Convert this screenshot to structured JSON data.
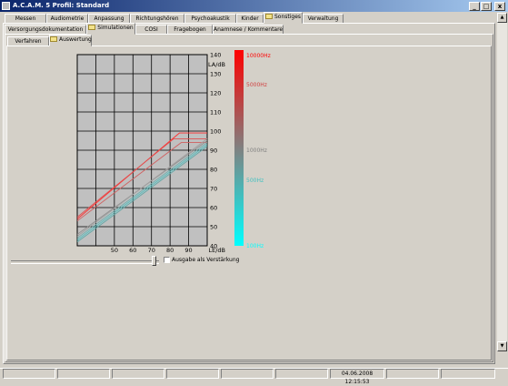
{
  "window": {
    "title": "A.C.A.M. 5  Profil: Standard",
    "minimize": "_",
    "maximize": "□",
    "close": "x"
  },
  "main_tabs": [
    {
      "label": "Messen"
    },
    {
      "label": "Audiometrie"
    },
    {
      "label": "Anpassung"
    },
    {
      "label": "Richtungshören"
    },
    {
      "label": "Psychoakustik"
    },
    {
      "label": "Kinder"
    },
    {
      "label": "Sonstiges"
    },
    {
      "label": "Verwaltung"
    }
  ],
  "sub_tabs": [
    {
      "label": "Versorgungsdokumentation"
    },
    {
      "label": "Simulationen"
    },
    {
      "label": "COSI"
    },
    {
      "label": "Fragebogen"
    },
    {
      "label": "Anamnese / Kommentare"
    }
  ],
  "third_tabs": [
    {
      "label": "Verfahren"
    },
    {
      "label": "Auswertung"
    }
  ],
  "checkbox": {
    "label": "Ausgabe als Verstärkung",
    "checked": false
  },
  "slider": {
    "value": 0.98
  },
  "status": {
    "datetime": "04.06.2008 12:15:53"
  },
  "colors": {
    "title_start": "#0a246a",
    "title_end": "#a6caf0",
    "plot_bg": "#c0c0c0"
  },
  "chart_data": {
    "type": "line",
    "xlabel": "LE/dB",
    "ylabel": "LA/dB",
    "x_ticks": [
      50,
      60,
      70,
      80,
      90
    ],
    "y_ticks": [
      40,
      50,
      60,
      70,
      80,
      90,
      100,
      110,
      120,
      130,
      140
    ],
    "xlim": [
      30,
      100
    ],
    "ylim": [
      40,
      140
    ],
    "grid": true,
    "colorbar": {
      "labels": [
        "10000Hz",
        "5000Hz",
        "1000Hz",
        "500Hz",
        "100Hz"
      ],
      "colors": [
        "#ff0000",
        "#d04040",
        "#808080",
        "#40c0c0",
        "#00ffff"
      ]
    },
    "series": [
      {
        "color": "#ff3030",
        "points": [
          [
            30,
            54
          ],
          [
            85,
            99
          ],
          [
            100,
            99
          ]
        ]
      },
      {
        "color": "#e05050",
        "points": [
          [
            30,
            55
          ],
          [
            82,
            96
          ],
          [
            100,
            96
          ]
        ]
      },
      {
        "color": "#d06060",
        "points": [
          [
            30,
            53
          ],
          [
            86,
            94
          ],
          [
            100,
            94
          ]
        ]
      },
      {
        "color": "#909090",
        "points": [
          [
            30,
            46
          ],
          [
            100,
            95
          ]
        ]
      },
      {
        "color": "#70b0b0",
        "points": [
          [
            30,
            44
          ],
          [
            100,
            94
          ]
        ]
      },
      {
        "color": "#50c0c0",
        "points": [
          [
            30,
            43
          ],
          [
            100,
            93
          ]
        ]
      },
      {
        "color": "#60a8a8",
        "points": [
          [
            30,
            42
          ],
          [
            100,
            92
          ]
        ]
      },
      {
        "color": "#a0a0a0",
        "points": [
          [
            30,
            45
          ],
          [
            100,
            96
          ]
        ]
      }
    ]
  }
}
